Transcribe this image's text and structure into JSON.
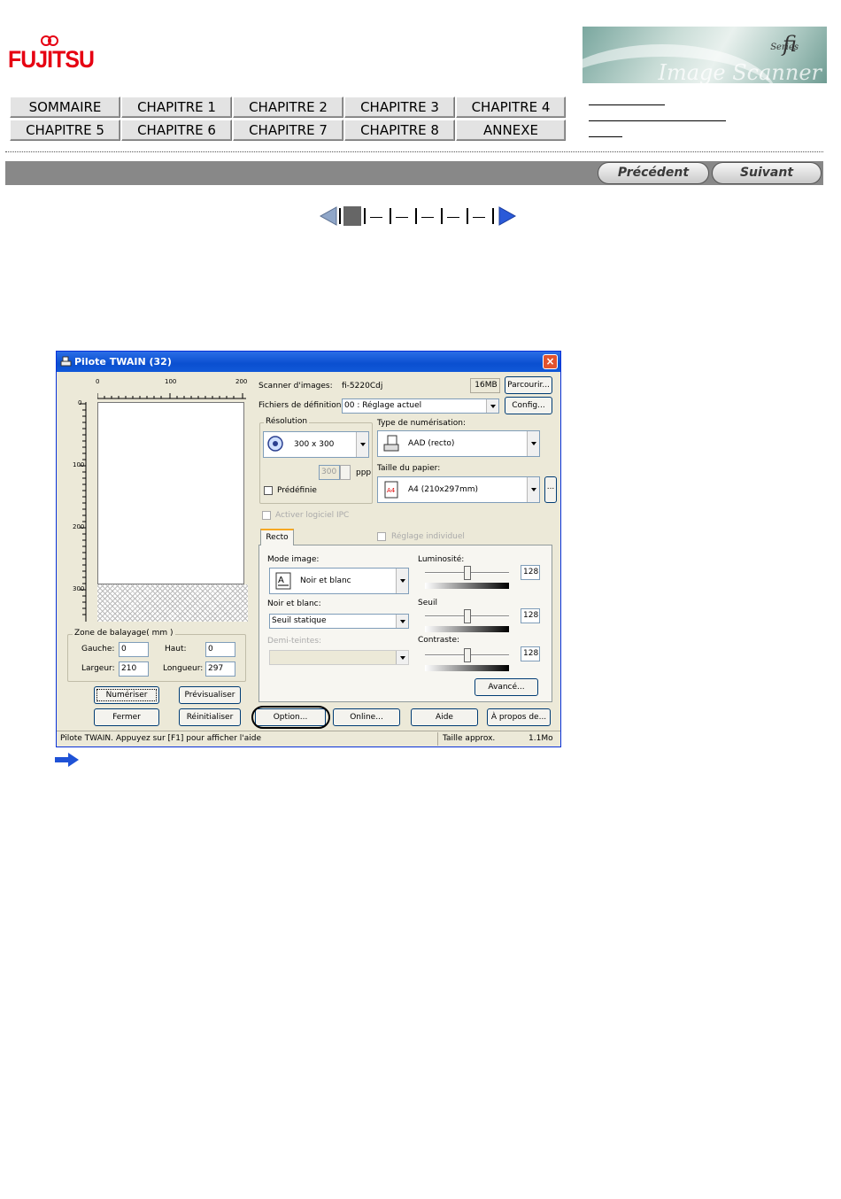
{
  "header": {
    "logo_text": "FUJITSU",
    "banner": {
      "fi": "fi",
      "series": "Series",
      "scanner": "Image Scanner"
    }
  },
  "chapters": [
    "SOMMAIRE",
    "CHAPITRE 1",
    "CHAPITRE 2",
    "CHAPITRE 3",
    "CHAPITRE 4",
    "CHAPITRE 5",
    "CHAPITRE 6",
    "CHAPITRE 7",
    "CHAPITRE 8",
    "ANNEXE"
  ],
  "nav": {
    "previous": "Précédent",
    "next": "Suivant"
  },
  "pager": {
    "current_page": 1,
    "total_pages": 7
  },
  "twain": {
    "title": "Pilote TWAIN (32)",
    "ruler_top": [
      "0",
      "100",
      "200"
    ],
    "ruler_left": [
      "0",
      "100",
      "200",
      "300"
    ],
    "scanner_label": "Scanner d'images:",
    "scanner_value": "fi-5220Cdj",
    "memory": "16MB",
    "browse": "Parcourir...",
    "definition_label": "Fichiers de définition:",
    "definition_value": "00 : Réglage actuel",
    "config": "Config...",
    "resolution_label": "Résolution",
    "resolution_value": "300 x 300",
    "dpi_value": "300",
    "dpi_unit": "ppp",
    "predefined": "Prédéfinie",
    "scan_type_label": "Type de numérisation:",
    "scan_type_value": "AAD (recto)",
    "paper_size_label": "Taille du papier:",
    "paper_size_value": "A4 (210x297mm)",
    "more": "...",
    "ipc": "Activer logiciel IPC",
    "tab_recto": "Recto",
    "individual": "Réglage individuel",
    "image_mode_label": "Mode image:",
    "image_mode_value": "Noir et blanc",
    "bw_label": "Noir et blanc:",
    "bw_value": "Seuil statique",
    "halftone_label": "Demi-teintes:",
    "brightness_label": "Luminosité:",
    "brightness_value": "128",
    "threshold_label": "Seuil",
    "threshold_value": "128",
    "contrast_label": "Contraste:",
    "contrast_value": "128",
    "advanced": "Avancé...",
    "scan_area_label": "Zone de balayage( mm )",
    "left_label": "Gauche:",
    "left_value": "0",
    "top_label": "Haut:",
    "top_value": "0",
    "width_label": "Largeur:",
    "width_value": "210",
    "length_label": "Longueur:",
    "length_value": "297",
    "scan_btn": "Numériser",
    "preview_btn": "Prévisualiser",
    "close_btn": "Fermer",
    "reset_btn": "Réinitialiser",
    "option_btn": "Option...",
    "online_btn": "Online...",
    "help_btn": "Aide",
    "about_btn": "À propos de...",
    "status_text": "Pilote TWAIN. Appuyez sur [F1] pour afficher l'aide",
    "size_label": "Taille approx.",
    "size_value": "1.1Mo"
  },
  "colors": {
    "brand_red": "#e60012",
    "bar_gray": "#888888",
    "pager_blue": "#2a5ad8"
  }
}
